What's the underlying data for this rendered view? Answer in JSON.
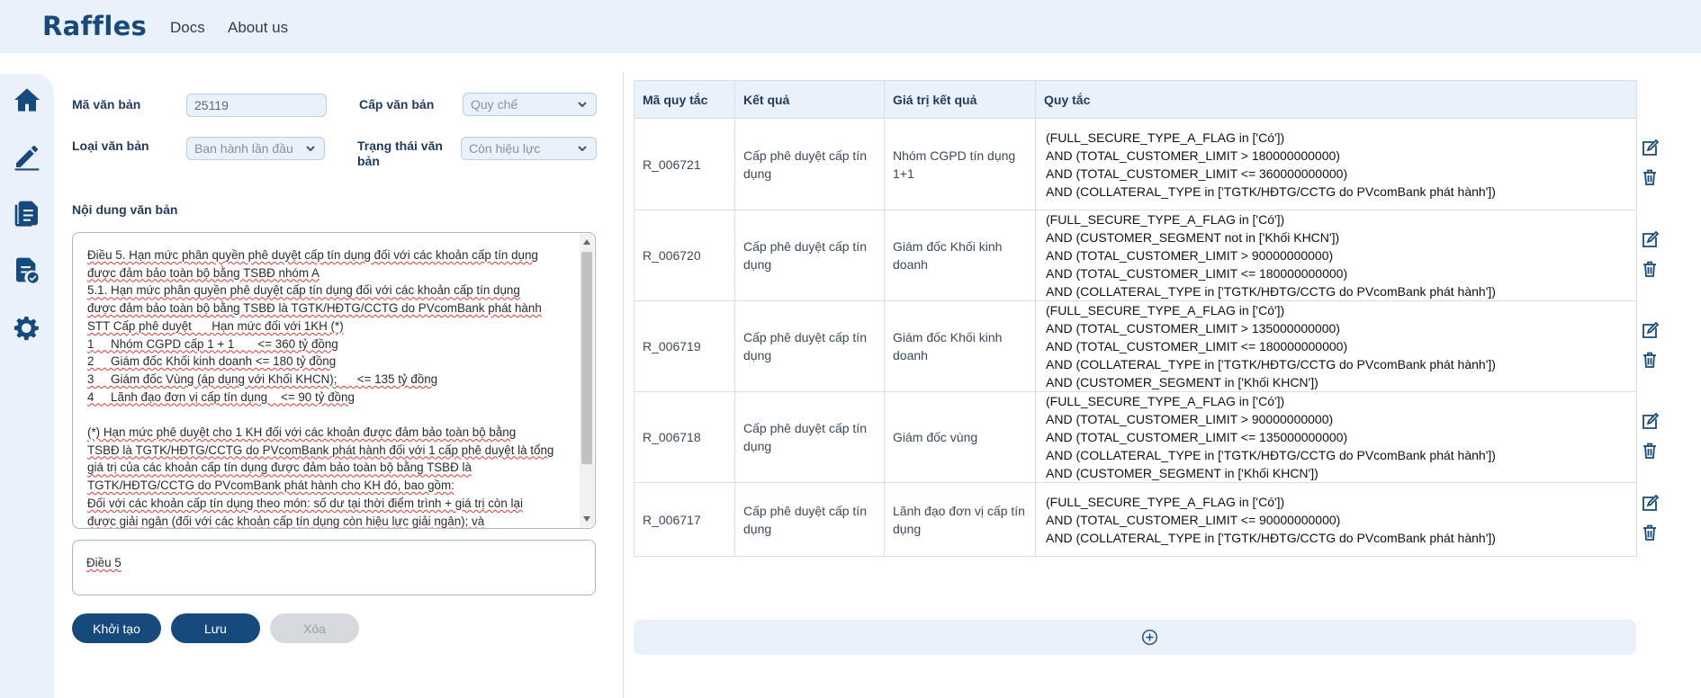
{
  "header": {
    "brand": "Raffles",
    "nav": [
      "Docs",
      "About us"
    ]
  },
  "sidebar": {
    "items": [
      {
        "icon": "home-icon",
        "label": "home"
      },
      {
        "icon": "edit-icon",
        "label": "edit"
      },
      {
        "icon": "document-icon",
        "label": "documents"
      },
      {
        "icon": "document-check-icon",
        "label": "verify"
      },
      {
        "icon": "gears-icon",
        "label": "settings"
      }
    ]
  },
  "form": {
    "ma_van_ban_label": "Mã văn bản",
    "ma_van_ban_value": "25119",
    "cap_van_ban_label": "Cấp văn bản",
    "cap_van_ban_value": "Quy chế",
    "loai_van_ban_label": "Loại văn bản",
    "loai_van_ban_value": "Ban hành lần đầu",
    "trang_thai_label": "Trạng thái văn bản",
    "trang_thai_value": "Còn hiệu lực",
    "noi_dung_label": "Nội dung văn bản",
    "heading_value": "Điều 5",
    "buttons": {
      "init": "Khởi tạo",
      "save": "Lưu",
      "delete": "Xóa"
    }
  },
  "document_lines": [
    "Điều 5. Hạn mức phân quyền phê duyệt cấp tín dụng đối với các khoản cấp tín dụng",
    "được đảm bảo toàn bộ bằng TSBĐ nhóm A",
    "5.1. Hạn mức phân quyền phê duyệt cấp tín dụng đối với các khoản cấp tín dụng",
    "được đảm bảo toàn bộ bằng TSBĐ là TGTK/HĐTG/CCTG do PVcomBank phát hành",
    "STT Cấp phê duyệt      Hạn mức đối với 1KH (*)",
    "1     Nhóm CGPD cấp 1 + 1       <= 360 tỷ đồng",
    "2     Giám đốc Khối kinh doanh <= 180 tỷ đồng",
    "3     Giám đốc Vùng (áp dụng với Khối KHCN);      <= 135 tỷ đồng",
    "4     Lãnh đạo đơn vị cấp tín dụng    <= 90 tỷ đồng",
    "",
    "(*) Hạn mức phê duyệt cho 1 KH đối với các khoản được đảm bảo toàn bộ bằng",
    "TSBĐ là TGTK/HĐTG/CCTG do PVcomBank phát hành đối với 1 cấp phê duyệt là tổng",
    "giá trị của các khoản cấp tín dụng được đảm bảo toàn bộ bằng TSBĐ là",
    "TGTK/HĐTG/CCTG do PVcomBank phát hành cho KH đó, bao gồm:",
    "Đối với các khoản cấp tín dụng theo món: số dư tại thời điểm trình + giá trị còn lại",
    "được giải ngân (đối với các khoản cấp tín dụng còn hiệu lực giải ngân); và"
  ],
  "table": {
    "headers": [
      "Mã quy tắc",
      "Kết quả",
      "Giá trị kết quả",
      "Quy tắc"
    ],
    "rows": [
      {
        "code": "R_006721",
        "result": "Cấp phê duyệt cấp tín dụng",
        "value": "Nhóm CGPD tín dụng 1+1",
        "rule": [
          "(FULL_SECURE_TYPE_A_FLAG in ['Có'])",
          "AND (TOTAL_CUSTOMER_LIMIT > 180000000000)",
          "AND (TOTAL_CUSTOMER_LIMIT <= 360000000000)",
          "AND (COLLATERAL_TYPE in ['TGTK/HĐTG/CCTG do PVcomBank phát hành'])"
        ]
      },
      {
        "code": "R_006720",
        "result": "Cấp phê duyệt cấp tín dụng",
        "value": "Giám đốc Khối kinh doanh",
        "rule": [
          "(FULL_SECURE_TYPE_A_FLAG in ['Có'])",
          "AND (CUSTOMER_SEGMENT not in ['Khối KHCN'])",
          "AND (TOTAL_CUSTOMER_LIMIT > 90000000000)",
          "AND (TOTAL_CUSTOMER_LIMIT <= 180000000000)",
          "AND (COLLATERAL_TYPE in ['TGTK/HĐTG/CCTG do PVcomBank phát hành'])"
        ]
      },
      {
        "code": "R_006719",
        "result": "Cấp phê duyệt cấp tín dụng",
        "value": "Giám đốc Khối kinh doanh",
        "rule": [
          "(FULL_SECURE_TYPE_A_FLAG in ['Có'])",
          "AND (TOTAL_CUSTOMER_LIMIT > 135000000000)",
          "AND (TOTAL_CUSTOMER_LIMIT <= 180000000000)",
          "AND (COLLATERAL_TYPE in ['TGTK/HĐTG/CCTG do PVcomBank phát hành'])",
          "AND (CUSTOMER_SEGMENT in ['Khối KHCN'])"
        ]
      },
      {
        "code": "R_006718",
        "result": "Cấp phê duyệt cấp tín dụng",
        "value": "Giám đốc vùng",
        "rule": [
          "(FULL_SECURE_TYPE_A_FLAG in ['Có'])",
          "AND (TOTAL_CUSTOMER_LIMIT > 90000000000)",
          "AND (TOTAL_CUSTOMER_LIMIT <= 135000000000)",
          "AND (COLLATERAL_TYPE in ['TGTK/HĐTG/CCTG do PVcomBank phát hành'])",
          "AND (CUSTOMER_SEGMENT in ['Khối KHCN'])"
        ]
      },
      {
        "code": "R_006717",
        "result": "Cấp phê duyệt cấp tín dụng",
        "value": "Lãnh đạo đơn vị cấp tín dụng",
        "rule": [
          "(FULL_SECURE_TYPE_A_FLAG in ['Có'])",
          "AND (TOTAL_CUSTOMER_LIMIT <= 90000000000)",
          "AND (COLLATERAL_TYPE in ['TGTK/HĐTG/CCTG do PVcomBank phát hành'])"
        ]
      }
    ]
  },
  "colors": {
    "brand": "#174a7c",
    "panel_bg": "#eaf1fb",
    "border": "#d6dee8"
  },
  "icons": {
    "edit": "edit-icon",
    "delete": "trash-icon",
    "add": "plus-circle-icon"
  }
}
